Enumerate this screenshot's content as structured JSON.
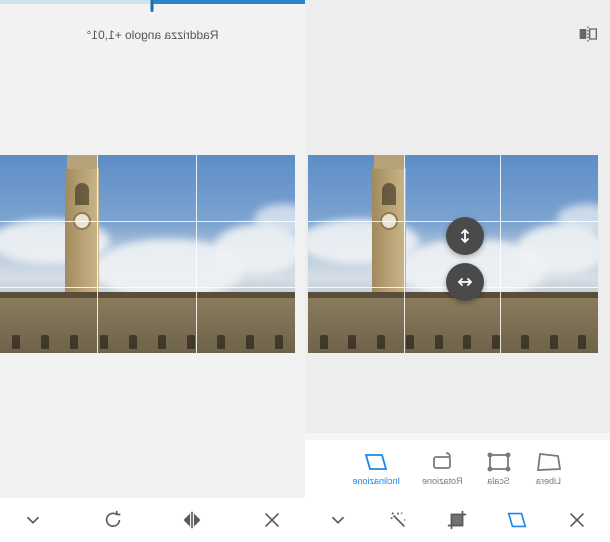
{
  "right": {
    "status_text": "Raddrizza angolo +1,01°"
  },
  "tabs": {
    "items": [
      {
        "label": "Libera"
      },
      {
        "label": "Scala"
      },
      {
        "label": "Rotazione"
      },
      {
        "label": "Inclinazione"
      }
    ]
  },
  "icons": {
    "mirror": "mirror-icon",
    "vert_arrow": "vertical-arrows-icon",
    "horz_arrow": "horizontal-arrows-icon",
    "libera": "free-transform-icon",
    "scala": "scale-icon",
    "rotazione": "rotate-frame-icon",
    "inclinazione": "skew-icon",
    "close": "close-icon",
    "expand": "expand-down-icon",
    "wand": "magic-wand-icon",
    "crop": "crop-icon",
    "skew_active": "skew-icon",
    "rotate_ccw": "rotate-ccw-icon",
    "flip_h": "flip-horizontal-icon"
  },
  "colors": {
    "accent": "#1d86e8"
  }
}
